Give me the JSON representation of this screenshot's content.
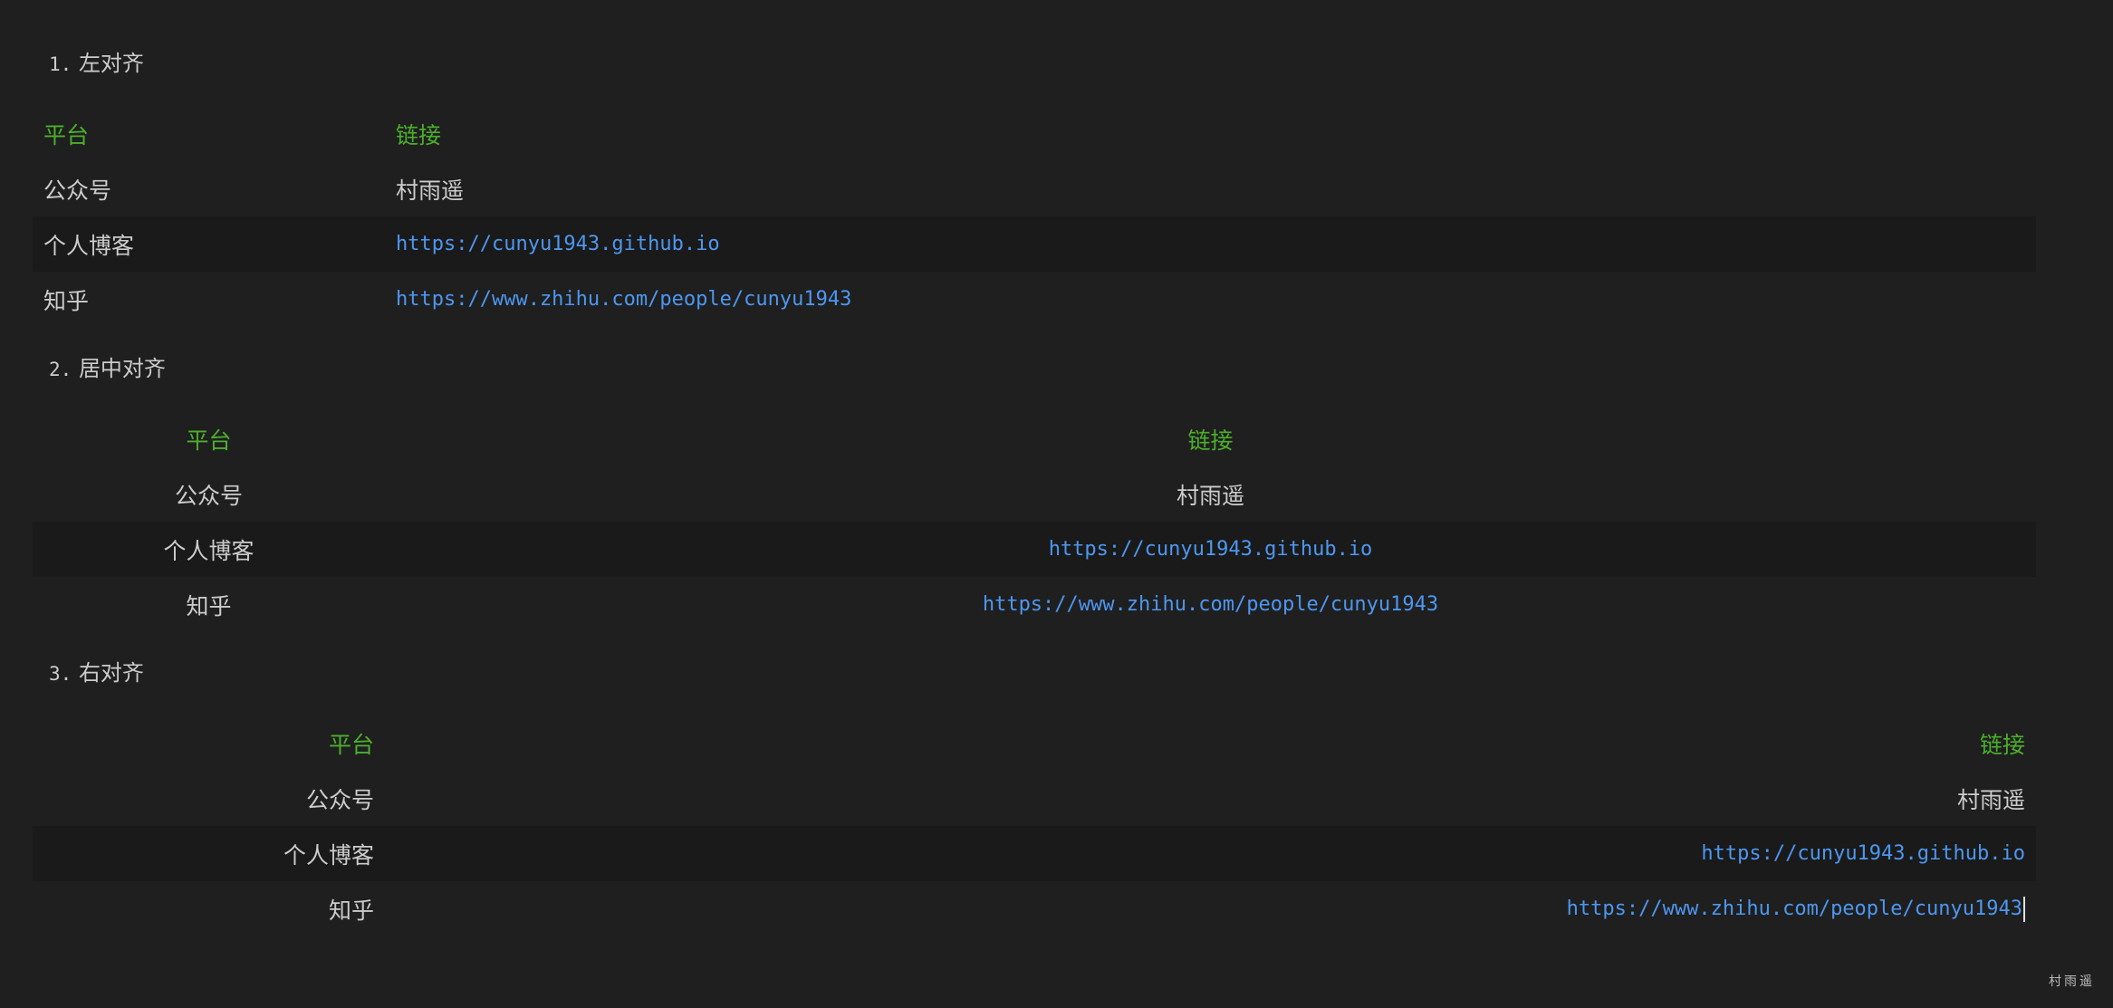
{
  "sections": [
    {
      "number": "1.",
      "title": "左对齐",
      "headers": [
        "平台",
        "链接"
      ],
      "rows": [
        {
          "platform": "公众号",
          "value": "村雨遥"
        },
        {
          "platform": "个人博客",
          "value": "https://cunyu1943.github.io"
        },
        {
          "platform": "知乎",
          "value": "https://www.zhihu.com/people/cunyu1943"
        }
      ]
    },
    {
      "number": "2.",
      "title": "居中对齐",
      "headers": [
        "平台",
        "链接"
      ],
      "rows": [
        {
          "platform": "公众号",
          "value": "村雨遥"
        },
        {
          "platform": "个人博客",
          "value": "https://cunyu1943.github.io"
        },
        {
          "platform": "知乎",
          "value": "https://www.zhihu.com/people/cunyu1943"
        }
      ]
    },
    {
      "number": "3.",
      "title": "右对齐",
      "headers": [
        "平台",
        "链接"
      ],
      "rows": [
        {
          "platform": "公众号",
          "value": "村雨遥"
        },
        {
          "platform": "个人博客",
          "value": "https://cunyu1943.github.io"
        },
        {
          "platform": "知乎",
          "value": "https://www.zhihu.com/people/cunyu1943"
        }
      ]
    }
  ],
  "watermark": "村雨遥",
  "colors": {
    "background": "#1f1f1f",
    "header_text": "#4caf2c",
    "link": "#4d97f0",
    "text": "#cccccc",
    "shaded_row": "#1a1a1a"
  }
}
